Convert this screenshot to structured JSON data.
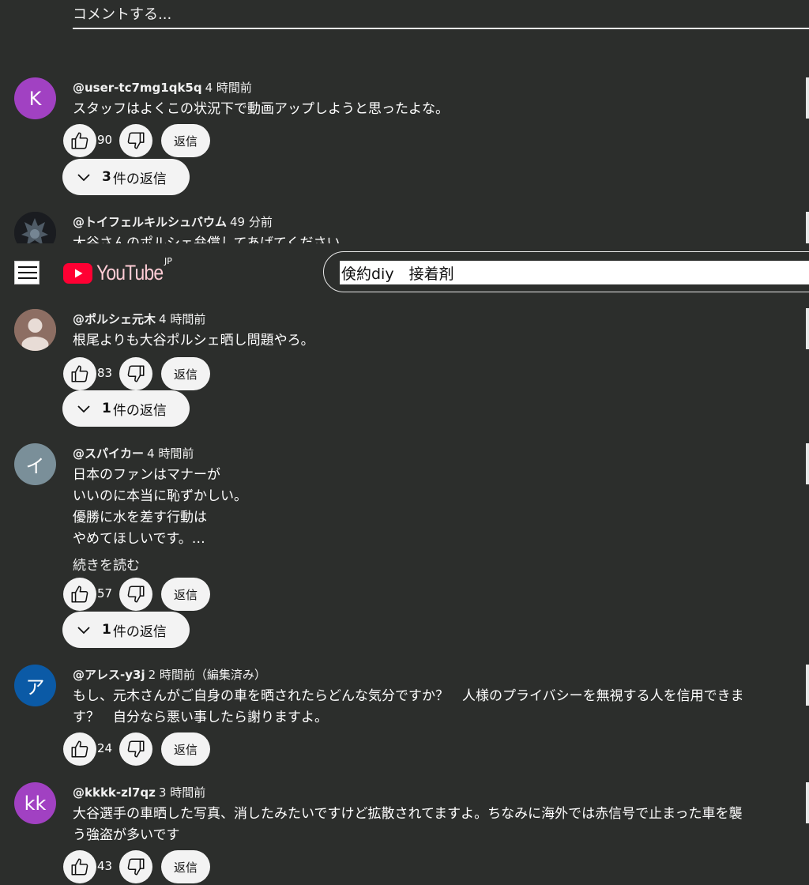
{
  "comment_box": {
    "placeholder": "コメントする..."
  },
  "header": {
    "logo_text": "YouTube",
    "region": "JP",
    "search_value": "倹約diy　接着剤"
  },
  "comments": [
    {
      "avatar_text": "K",
      "avatar_color": "#a141c2",
      "author": "@user-tc7mg1qk5q",
      "time": "4 時間前",
      "lines": [
        "スタッフはよくこの状況下で動画アップしようと思ったよな。"
      ],
      "likes": "90",
      "reply_label": "返信",
      "replies": {
        "count": "3",
        "label": "件の返信"
      }
    },
    {
      "avatar_text": "",
      "avatar_color": "#1a1c20",
      "author": "@トイフェルキルシュバウム",
      "time": "49 分前",
      "lines": [
        "大谷さんのポルシェ弁償してあげてください。"
      ]
    },
    {
      "avatar_text": "",
      "avatar_color": "#8d6e63",
      "author": "@ポルシェ元木",
      "time": "4 時間前",
      "lines": [
        "根尾よりも大谷ポルシェ晒し問題やろ。"
      ],
      "likes": "83",
      "reply_label": "返信",
      "replies": {
        "count": "1",
        "label": "件の返信"
      }
    },
    {
      "avatar_text": "イ",
      "avatar_color": "#7a8f99",
      "author": "@スパイカー",
      "time": "4 時間前",
      "lines": [
        "日本のファンはマナーが",
        "いいのに本当に恥ずかしい。",
        "優勝に水を差す行動は",
        "やめてほしいです。…"
      ],
      "read_more": "続きを読む",
      "likes": "57",
      "reply_label": "返信",
      "replies": {
        "count": "1",
        "label": "件の返信"
      }
    },
    {
      "avatar_text": "ア",
      "avatar_color": "#0b5aa6",
      "author": "@アレス-y3j",
      "time": "2 時間前（編集済み）",
      "lines": [
        "もし、元木さんがご自身の車を晒されたらどんな気分ですか？　人様のプライバシーを無視する人を信用できま",
        "す？　自分なら悪い事したら謝りますよ。"
      ],
      "likes": "24",
      "reply_label": "返信"
    },
    {
      "avatar_text": "kk",
      "avatar_color": "#a141c2",
      "author": "@kkkk-zl7qz",
      "time": "3 時間前",
      "lines": [
        "大谷選手の車晒した写真、消したみたいですけど拡散されてますよ。ちなみに海外では赤信号で止まった車を襲",
        "う強盗が多いです"
      ],
      "likes": "43",
      "reply_label": "返信"
    }
  ]
}
